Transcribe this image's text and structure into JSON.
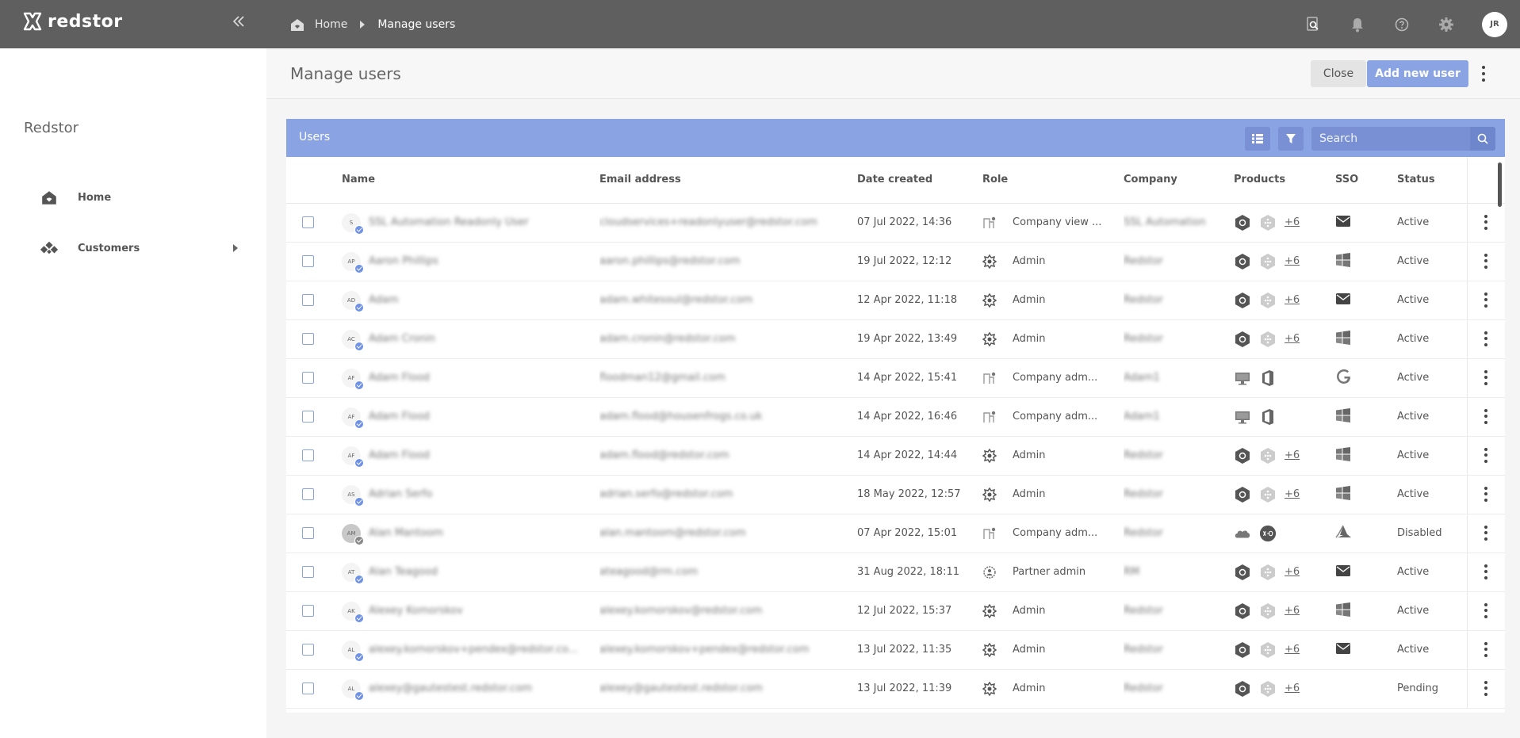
{
  "app": {
    "brand": "redstor",
    "user_initials": "JR"
  },
  "breadcrumb": {
    "home": "Home",
    "current": "Manage users"
  },
  "top_icons": [
    "search-logs-icon",
    "bell-icon",
    "help-icon",
    "gear-icon"
  ],
  "sidebar": {
    "org_name": "Redstor",
    "items": [
      {
        "label": "Home",
        "icon": "home-icon"
      },
      {
        "label": "Customers",
        "icon": "customers-icon"
      }
    ]
  },
  "page": {
    "title": "Manage users",
    "close_label": "Close",
    "add_label": "Add new user"
  },
  "panel": {
    "title": "Users",
    "search_placeholder": "Search"
  },
  "table": {
    "columns": [
      "Name",
      "Email address",
      "Date created",
      "Role",
      "Company",
      "Products",
      "SSO",
      "Status"
    ],
    "rows": [
      {
        "initials": "S",
        "name": "SSL Automation Readonly User",
        "email": "cloudservices+readonlyuser@redstor.com",
        "date": "07 Jul 2022, 14:36",
        "role": "Company view ...",
        "role_icon": "company",
        "company": "SSL Automation",
        "products": "standard",
        "more": "+6",
        "sso": "email",
        "status": "Active"
      },
      {
        "initials": "AP",
        "name": "Aaron Phillips",
        "email": "aaron.phillips@redstor.com",
        "date": "19 Jul 2022, 12:12",
        "role": "Admin",
        "role_icon": "admin",
        "company": "Redstor",
        "products": "standard",
        "more": "+6",
        "sso": "windows",
        "status": "Active"
      },
      {
        "initials": "AD",
        "name": "Adam",
        "email": "adam.whitesoul@redstor.com",
        "date": "12 Apr 2022, 11:18",
        "role": "Admin",
        "role_icon": "admin",
        "company": "Redstor",
        "products": "standard",
        "more": "+6",
        "sso": "email",
        "status": "Active"
      },
      {
        "initials": "AC",
        "name": "Adam Cronin",
        "email": "adam.cronin@redstor.com",
        "date": "19 Apr 2022, 13:49",
        "role": "Admin",
        "role_icon": "admin",
        "company": "Redstor",
        "products": "standard",
        "more": "+6",
        "sso": "windows",
        "status": "Active"
      },
      {
        "initials": "AF",
        "name": "Adam Flood",
        "email": "floodman12@gmail.com",
        "date": "14 Apr 2022, 15:41",
        "role": "Company adm...",
        "role_icon": "company",
        "company": "Adam1",
        "products": "desktop",
        "more": "",
        "sso": "google",
        "status": "Active"
      },
      {
        "initials": "AF",
        "name": "Adam Flood",
        "email": "adam.flood@housenfrogs.co.uk",
        "date": "14 Apr 2022, 16:46",
        "role": "Company adm...",
        "role_icon": "company",
        "company": "Adam1",
        "products": "desktop",
        "more": "",
        "sso": "windows",
        "status": "Active"
      },
      {
        "initials": "AF",
        "name": "Adam Flood",
        "email": "adam.flood@redstor.com",
        "date": "14 Apr 2022, 14:44",
        "role": "Admin",
        "role_icon": "admin",
        "company": "Redstor",
        "products": "standard",
        "more": "+6",
        "sso": "windows",
        "status": "Active"
      },
      {
        "initials": "AS",
        "name": "Adrian Serfo",
        "email": "adrian.serfo@redstor.com",
        "date": "18 May 2022, 12:57",
        "role": "Admin",
        "role_icon": "admin",
        "company": "Redstor",
        "products": "standard",
        "more": "+6",
        "sso": "windows",
        "status": "Active"
      },
      {
        "initials": "AM",
        "name": "Alan Mantoom",
        "email": "alan.mantoom@redstor.com",
        "date": "07 Apr 2022, 15:01",
        "role": "Company adm...",
        "role_icon": "company",
        "company": "Redstor",
        "products": "saas",
        "more": "",
        "sso": "azure",
        "status": "Disabled"
      },
      {
        "initials": "AT",
        "name": "Alan Teagood",
        "email": "ateagood@rm.com",
        "date": "31 Aug 2022, 18:11",
        "role": "Partner admin",
        "role_icon": "partner",
        "company": "RM",
        "products": "standard",
        "more": "+6",
        "sso": "email",
        "status": "Active"
      },
      {
        "initials": "AK",
        "name": "Alexey Komorskov",
        "email": "alexey.komorskov@redstor.com",
        "date": "12 Jul 2022, 15:37",
        "role": "Admin",
        "role_icon": "admin",
        "company": "Redstor",
        "products": "standard",
        "more": "+6",
        "sso": "windows",
        "status": "Active"
      },
      {
        "initials": "AL",
        "name": "alexey.komorskov+pendex@redstor.co...",
        "email": "alexey.komorskov+pendex@redstor.com",
        "date": "13 Jul 2022, 11:35",
        "role": "Admin",
        "role_icon": "admin",
        "company": "Redstor",
        "products": "standard",
        "more": "+6",
        "sso": "email",
        "status": "Active"
      },
      {
        "initials": "AL",
        "name": "alexey@gautestest.redstor.com",
        "email": "alexey@gautestest.redstor.com",
        "date": "13 Jul 2022, 11:39",
        "role": "Admin",
        "role_icon": "admin",
        "company": "Redstor",
        "products": "standard",
        "more": "+6",
        "sso": "",
        "status": "Pending"
      }
    ]
  }
}
